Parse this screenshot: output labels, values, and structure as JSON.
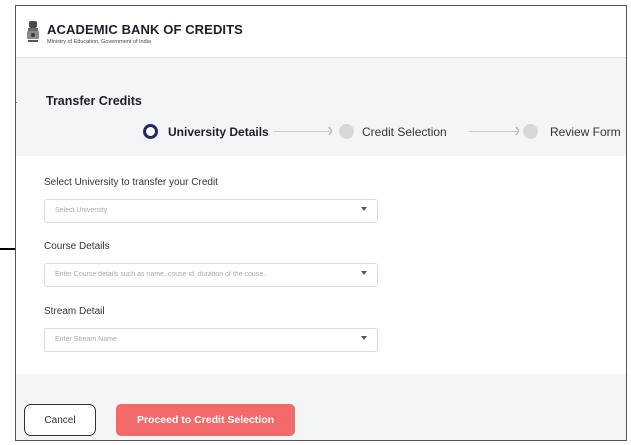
{
  "header": {
    "title": "ACADEMIC BANK OF CREDITS",
    "subtitle": "Ministry of Education, Government of India"
  },
  "page": {
    "back_icon": "left-arrow-icon",
    "title": "Transfer Credits"
  },
  "stepper": {
    "steps": [
      {
        "label": "University Details",
        "state": "active"
      },
      {
        "label": "Credit Selection",
        "state": "pending"
      },
      {
        "label": "Review Form",
        "state": "pending"
      }
    ]
  },
  "form": {
    "university": {
      "label": "Select University to transfer your Credit",
      "placeholder": "Select University"
    },
    "course": {
      "label": "Course Details",
      "placeholder": "Enter Course details such as name, couse id, duration of the couse.."
    },
    "stream": {
      "label": "Stream Detail",
      "placeholder": "Enter Stream Name"
    }
  },
  "footer": {
    "cancel_label": "Cancel",
    "proceed_label": "Proceed to Credit Selection"
  },
  "colors": {
    "accent": "#1f2a6b",
    "proceed": "#f46a6a",
    "pending_step": "#d8d8d8"
  }
}
